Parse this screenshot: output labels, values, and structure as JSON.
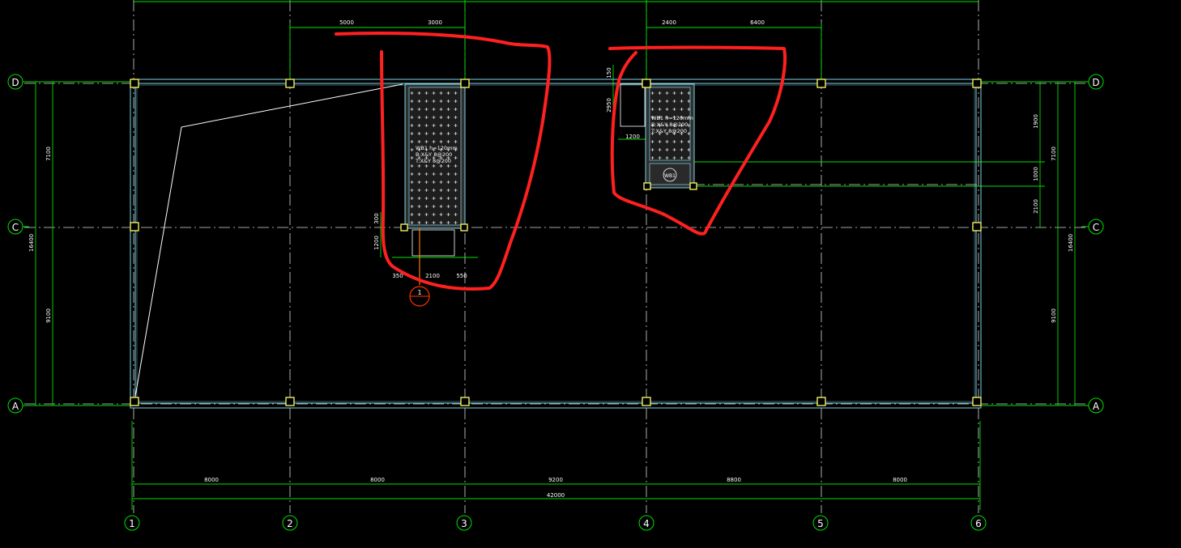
{
  "colors": {
    "background": "#000000",
    "grid_axis": "#e8e8e8",
    "dimension": "#00ff00",
    "wall": "#7fd3e6",
    "column": "#ffff66",
    "markup": "#ff2020",
    "slab_fill": "#3a3a3a",
    "text": "#ffffff"
  },
  "grid": {
    "vertical_axes": [
      "1",
      "2",
      "3",
      "4",
      "5",
      "6"
    ],
    "horizontal_axes": [
      "D",
      "C",
      "A"
    ]
  },
  "dimensions": {
    "top_left": [
      "5000",
      "3000"
    ],
    "top_right": [
      "2400",
      "6400"
    ],
    "bottom_spans": [
      "8000",
      "8000",
      "9200",
      "8800",
      "8000"
    ],
    "bottom_total": "42000",
    "left_outer": "16400",
    "left_upper": "7100",
    "left_lower": "9100",
    "right_outer": "16400",
    "right_upper": "7100",
    "right_lower": "9100",
    "right_inner": [
      "1900",
      "1000",
      "2100"
    ],
    "opening_left": {
      "depth_a": "300",
      "depth_b": "1200",
      "left_offset": "350",
      "width": "2100",
      "right_offset": "550"
    },
    "opening_right": {
      "top": "150",
      "depth": "2950",
      "width": "1200"
    }
  },
  "slab_notes": {
    "left": [
      "WB1 h=120mm",
      "B:X&Y 8@200",
      "T:X&Y 8@200"
    ],
    "right": [
      "WB1 h=120mm",
      "B:X&Y 8@200",
      "T:X&Y 8@200"
    ],
    "right_tag": "WB1"
  },
  "section_marker": "1"
}
